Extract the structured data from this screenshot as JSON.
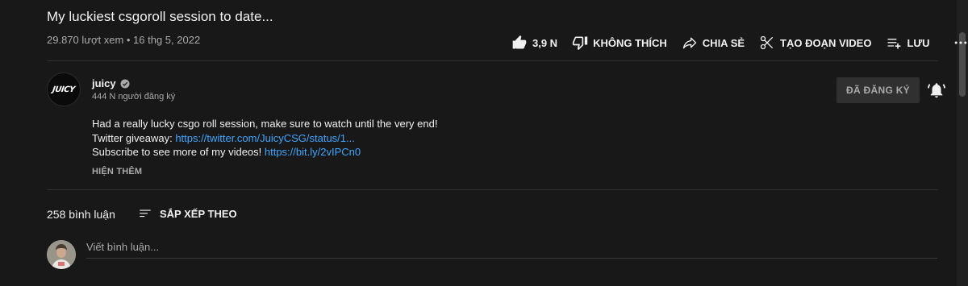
{
  "video": {
    "title": "My luckiest csgoroll session to date...",
    "meta": "29.870 lượt xem • 16 thg 5, 2022"
  },
  "actions": {
    "like": "3,9 N",
    "dislike": "KHÔNG THÍCH",
    "share": "CHIA SẺ",
    "clip": "TẠO ĐOẠN VIDEO",
    "save": "LƯU"
  },
  "channel": {
    "name": "juicy",
    "avatar_text": "JUICY",
    "subscribers": "444 N người đăng ký",
    "subscribe_button": "ĐÃ ĐĂNG KÝ"
  },
  "description": {
    "line1": "Had a really lucky csgo roll session, make sure to watch until the very end!",
    "line2_prefix": "Twitter giveaway: ",
    "line2_link": "https://twitter.com/JuicyCSG/status/1...",
    "line3_prefix": "Subscribe to see more of my videos! ",
    "line3_link": "https://bit.ly/2vIPCn0",
    "show_more": "HIỆN THÊM"
  },
  "comments": {
    "count": "258 bình luận",
    "sort_label": "SẮP XẾP THEO",
    "placeholder": "Viết bình luận..."
  },
  "colors": {
    "background": "#181818",
    "link": "#3ea6ff",
    "muted": "#aaaaaa"
  }
}
